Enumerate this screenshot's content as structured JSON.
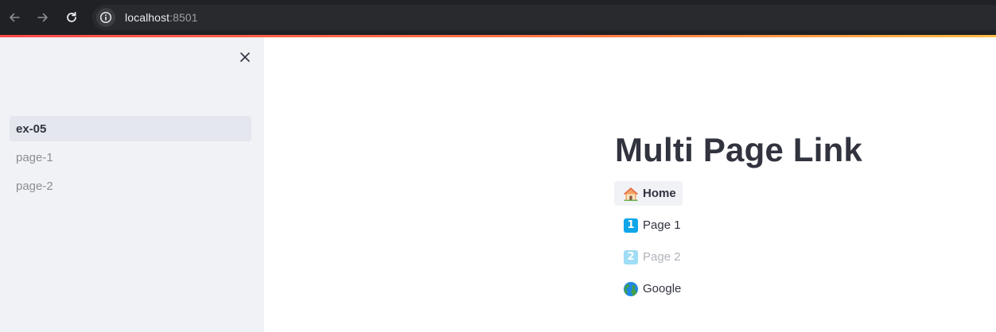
{
  "browser": {
    "host": "localhost",
    "port": ":8501"
  },
  "sidebar": {
    "items": [
      {
        "label": "ex-05",
        "active": true
      },
      {
        "label": "page-1",
        "active": false
      },
      {
        "label": "page-2",
        "active": false
      }
    ]
  },
  "main": {
    "title": "Multi Page Link",
    "links": [
      {
        "label": "Home",
        "icon": "house-icon"
      },
      {
        "label": "Page 1",
        "icon": "keycap-1-icon",
        "badge": "1"
      },
      {
        "label": "Page 2",
        "icon": "keycap-2-icon",
        "badge": "2"
      },
      {
        "label": "Google",
        "icon": "globe-icon"
      }
    ]
  },
  "colors": {
    "accent_stripe_start": "#ff4b4b",
    "accent_stripe_end": "#ffbd45",
    "text_primary": "#31333f",
    "badge_blue": "#0ea5e9"
  }
}
